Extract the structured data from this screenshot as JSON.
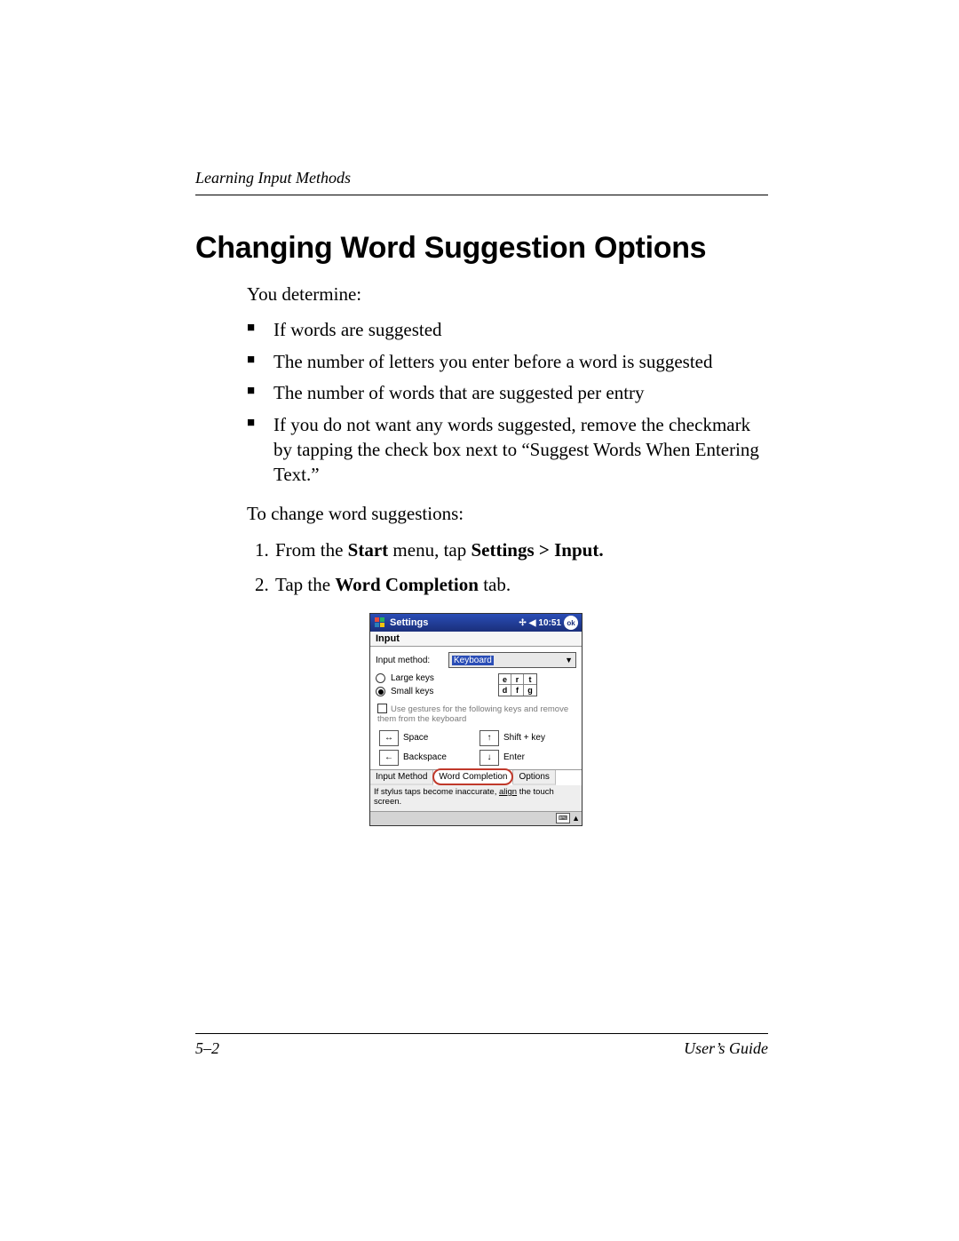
{
  "chapter_label": "Learning Input Methods",
  "title": "Changing Word Suggestion Options",
  "intro": "You determine:",
  "bullets": [
    "If words are suggested",
    "The number of letters you enter before a word is suggested",
    "The number of words that are suggested per entry",
    "If you do not want any words suggested, remove the checkmark by tapping the check box next to “Suggest Words When Entering Text.”"
  ],
  "lead": "To change word suggestions:",
  "steps": {
    "s1_pre": "From the ",
    "s1_b1": "Start",
    "s1_mid": " menu, tap ",
    "s1_b2": "Settings > Input.",
    "s2_pre": "Tap the ",
    "s2_b1": "Word Completion",
    "s2_post": " tab."
  },
  "pda": {
    "titlebar": "Settings",
    "time": "10:51",
    "ok": "ok",
    "sub": "Input",
    "input_method_label": "Input method:",
    "input_method_value": "Keyboard",
    "large_keys": "Large keys",
    "small_keys": "Small keys",
    "mini_keys": [
      "e",
      "r",
      "t",
      "d",
      "f",
      "g"
    ],
    "gest_text": "Use gestures for the following keys and remove them from the keyboard",
    "g_space": "Space",
    "g_shift": "Shift + key",
    "g_back": "Backspace",
    "g_enter": "Enter",
    "tabs": {
      "t1": "Input Method",
      "t2": "Word Completion",
      "t3": "Options"
    },
    "foot_pre": "If stylus taps become inaccurate, ",
    "foot_link": "align",
    "foot_post": " the touch screen."
  },
  "footer": {
    "page": "5–2",
    "guide": "User’s Guide"
  }
}
